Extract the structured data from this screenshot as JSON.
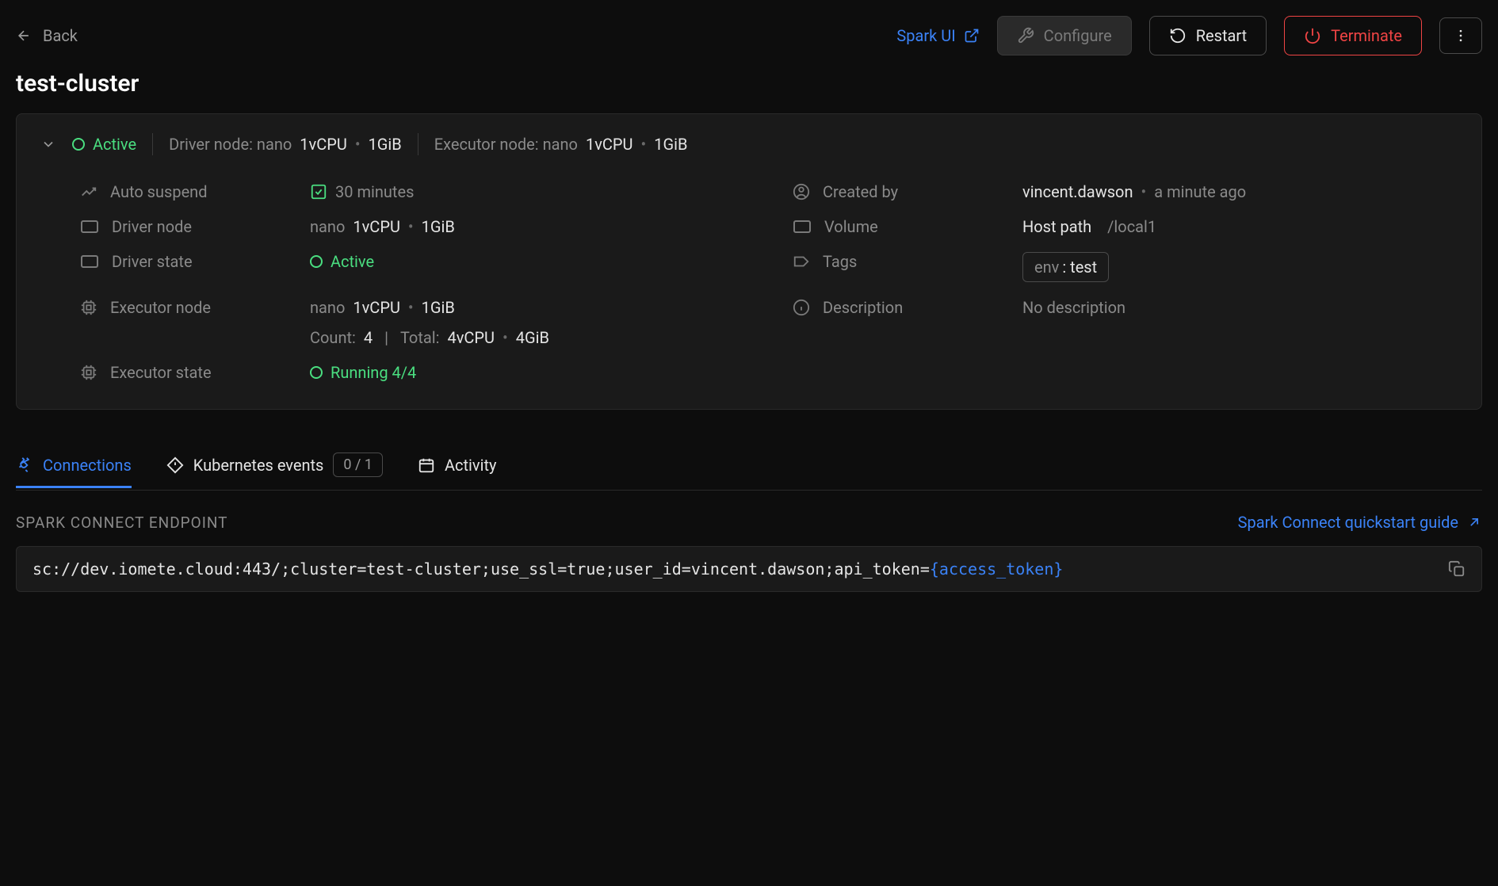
{
  "header": {
    "back": "Back",
    "spark_ui": "Spark UI",
    "configure": "Configure",
    "restart": "Restart",
    "terminate": "Terminate"
  },
  "title": "test-cluster",
  "summary": {
    "status": "Active",
    "driver_label": "Driver node: nano",
    "driver_cpu": "1vCPU",
    "driver_mem": "1GiB",
    "executor_label": "Executor node: nano",
    "executor_cpu": "1vCPU",
    "executor_mem": "1GiB"
  },
  "details": {
    "auto_suspend_label": "Auto suspend",
    "auto_suspend_value": "30 minutes",
    "driver_node_label": "Driver node",
    "driver_node_type": "nano",
    "driver_node_cpu": "1vCPU",
    "driver_node_mem": "1GiB",
    "driver_state_label": "Driver state",
    "driver_state_value": "Active",
    "executor_node_label": "Executor node",
    "executor_node_type": "nano",
    "executor_node_cpu": "1vCPU",
    "executor_node_mem": "1GiB",
    "executor_count_label": "Count:",
    "executor_count": "4",
    "executor_total_label": "Total:",
    "executor_total_cpu": "4vCPU",
    "executor_total_mem": "4GiB",
    "executor_state_label": "Executor state",
    "executor_state_value": "Running 4/4",
    "created_by_label": "Created by",
    "created_by_user": "vincent.dawson",
    "created_by_time": "a minute ago",
    "volume_label": "Volume",
    "volume_type": "Host path",
    "volume_path": "/local1",
    "tags_label": "Tags",
    "tag_key": "env",
    "tag_value": ": test",
    "description_label": "Description",
    "description_value": "No description"
  },
  "tabs": {
    "connections": "Connections",
    "kubernetes": "Kubernetes events",
    "kubernetes_badge": "0 / 1",
    "activity": "Activity"
  },
  "endpoint": {
    "title": "SPARK CONNECT ENDPOINT",
    "guide": "Spark Connect quickstart guide",
    "url_prefix": "sc://dev.iomete.cloud:443/;cluster=test-cluster;use_ssl=true;user_id=vincent.dawson;api_token=",
    "url_token": "{access_token}"
  }
}
